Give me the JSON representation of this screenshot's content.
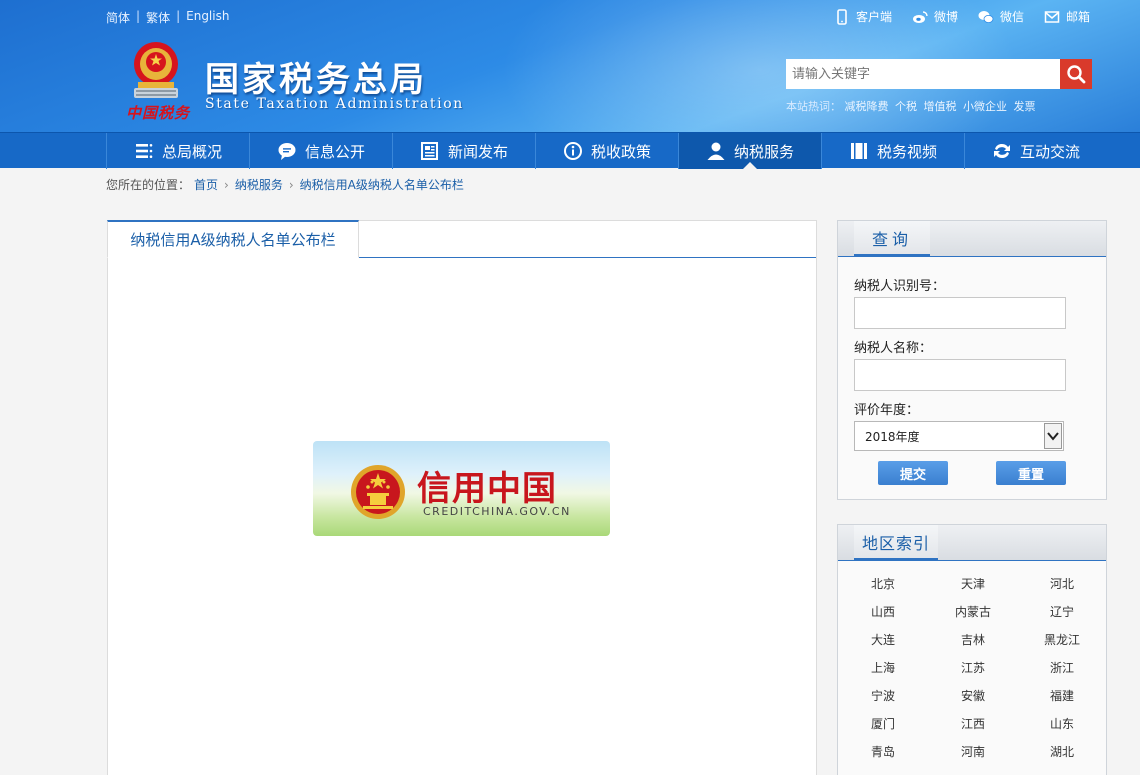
{
  "header": {
    "lang": [
      "简体",
      "繁体",
      "English"
    ],
    "toplinks": [
      {
        "label": "客户端",
        "icon": "mobile-icon"
      },
      {
        "label": "微博",
        "icon": "weibo-icon"
      },
      {
        "label": "微信",
        "icon": "wechat-icon"
      },
      {
        "label": "邮箱",
        "icon": "mail-icon"
      }
    ],
    "title": "国家税务总局",
    "subtitle": "State Taxation Administration",
    "signature": "中国税务",
    "search_placeholder": "请输入关键字",
    "hot_label": "本站热词：",
    "hot_words": [
      "减税降费",
      "个税",
      "增值税",
      "小微企业",
      "发票"
    ]
  },
  "nav": {
    "items": [
      {
        "label": "总局概况",
        "icon": "menu-icon"
      },
      {
        "label": "信息公开",
        "icon": "speech-bubble-icon"
      },
      {
        "label": "新闻发布",
        "icon": "newspaper-icon"
      },
      {
        "label": "税收政策",
        "icon": "info-icon"
      },
      {
        "label": "纳税服务",
        "icon": "person-icon",
        "active": true
      },
      {
        "label": "税务视频",
        "icon": "video-icon"
      },
      {
        "label": "互动交流",
        "icon": "exchange-icon"
      }
    ]
  },
  "breadcrumb": {
    "prefix": "您所在的位置：",
    "items": [
      "首页",
      "纳税服务",
      "纳税信用A级纳税人名单公布栏"
    ]
  },
  "main": {
    "tab": "纳税信用A级纳税人名单公布栏",
    "banner_title": "信用中国",
    "banner_url": "CREDITCHINA.GOV.CN"
  },
  "query": {
    "title": "查询",
    "taxpayer_id_label": "纳税人识别号：",
    "taxpayer_name_label": "纳税人名称：",
    "year_label": "评价年度：",
    "year_value": "2018年度",
    "submit": "提交",
    "reset": "重置"
  },
  "region": {
    "title": "地区索引",
    "items": [
      "北京",
      "天津",
      "河北",
      "山西",
      "内蒙古",
      "辽宁",
      "大连",
      "吉林",
      "黑龙江",
      "上海",
      "江苏",
      "浙江",
      "宁波",
      "安徽",
      "福建",
      "厦门",
      "江西",
      "山东",
      "青岛",
      "河南",
      "湖北"
    ]
  },
  "colors": {
    "header_blue": "#2d8be6",
    "nav_blue": "#1769c7",
    "link_blue": "#1b5fa8",
    "search_red": "#d93a2b",
    "credit_red": "#c8161d"
  }
}
